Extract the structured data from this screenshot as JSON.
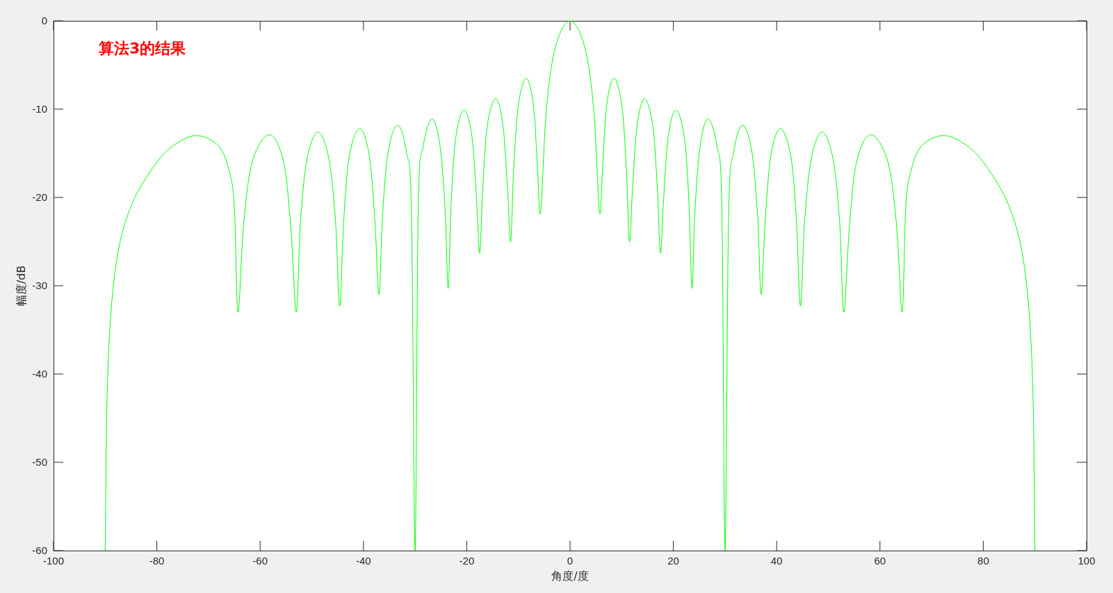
{
  "figure": {
    "chart_data": {
      "type": "line",
      "xlabel": "角度/度",
      "ylabel": "幅度/dB",
      "xlim": [
        -100,
        100
      ],
      "ylim": [
        -60,
        0
      ],
      "xticks": [
        -100,
        -80,
        -60,
        -40,
        -20,
        0,
        20,
        40,
        60,
        80,
        100
      ],
      "yticks": [
        -60,
        -50,
        -40,
        -30,
        -20,
        -10,
        0
      ],
      "annotations": [
        "算法3的结果"
      ],
      "x": [
        -90,
        -89.5,
        -88,
        -85,
        -80,
        -76,
        -72,
        -68,
        -66,
        -65,
        -64.3,
        -63.2,
        -61.5,
        -58.2,
        -55.5,
        -54.1,
        -53,
        -52.2,
        -50.9,
        -48.8,
        -46.7,
        -45.4,
        -44.6,
        -43.8,
        -42.7,
        -40.7,
        -38.9,
        -37.8,
        -37,
        -36.3,
        -35.2,
        -33.4,
        -31.7,
        -30.7,
        -30,
        -29.4,
        -28.4,
        -26.7,
        -25.2,
        -24.2,
        -23.6,
        -23,
        -22.1,
        -20.5,
        -19,
        -18.1,
        -17.5,
        -16.9,
        -16,
        -14.4,
        -13,
        -12.1,
        -11.5,
        -10.9,
        -10,
        -8.5,
        -7.1,
        -6.3,
        -5.7,
        -4.6,
        -2.85,
        0,
        2.85,
        4.6,
        5.7,
        6.3,
        7.1,
        8.5,
        10,
        10.9,
        11.5,
        12.1,
        13,
        14.4,
        16,
        16.9,
        17.5,
        18.1,
        19,
        20.5,
        22.1,
        23,
        23.6,
        24.2,
        25.2,
        26.7,
        28.4,
        29.4,
        30,
        30.7,
        31.7,
        33.4,
        35.2,
        36.3,
        37,
        37.8,
        38.9,
        40.7,
        42.7,
        43.8,
        44.6,
        45.4,
        46.7,
        48.8,
        50.9,
        52.2,
        53,
        54.1,
        55.5,
        58.2,
        61.5,
        63.2,
        64.3,
        65,
        66,
        68,
        72,
        76,
        80,
        85,
        88,
        89.5,
        90
      ],
      "series": [
        {
          "color": "#00ff00",
          "values": [
            -60,
            -40,
            -28,
            -21,
            -16,
            -13.8,
            -13,
            -14.2,
            -17,
            -21,
            -33,
            -23.1,
            -15.9,
            -12.9,
            -15.9,
            -23.1,
            -33,
            -22.8,
            -15.6,
            -12.6,
            -15.6,
            -22.8,
            -32.3,
            -22.4,
            -15.2,
            -12.2,
            -15.2,
            -22.4,
            -31,
            -22,
            -14.8,
            -11.8,
            -14.8,
            -22,
            -60,
            -21.3,
            -14.1,
            -11.1,
            -14.1,
            -21.3,
            -30.3,
            -20.3,
            -13.1,
            -10.1,
            -13.1,
            -20.3,
            -26.3,
            -19,
            -11.8,
            -8.8,
            -11.8,
            -19,
            -25,
            -16.7,
            -9.5,
            -6.5,
            -9.5,
            -16.7,
            -21.7,
            -10.2,
            -3,
            0,
            -3,
            -10.2,
            -21.7,
            -16.7,
            -9.5,
            -6.5,
            -9.5,
            -16.7,
            -25,
            -19,
            -11.8,
            -8.8,
            -11.8,
            -19,
            -26.3,
            -20.3,
            -13.1,
            -10.1,
            -13.1,
            -20.3,
            -30.3,
            -21.3,
            -14.1,
            -11.1,
            -14.1,
            -21.3,
            -60,
            -22,
            -14.8,
            -11.8,
            -14.8,
            -22,
            -31,
            -22.4,
            -15.2,
            -12.2,
            -15.2,
            -22.4,
            -32.3,
            -22.8,
            -15.6,
            -12.6,
            -15.6,
            -22.8,
            -33,
            -23.1,
            -15.9,
            -12.9,
            -15.9,
            -23.1,
            -33,
            -21,
            -17,
            -14.2,
            -13,
            -13.8,
            -16,
            -21,
            -28,
            -40,
            -60
          ]
        }
      ]
    }
  }
}
